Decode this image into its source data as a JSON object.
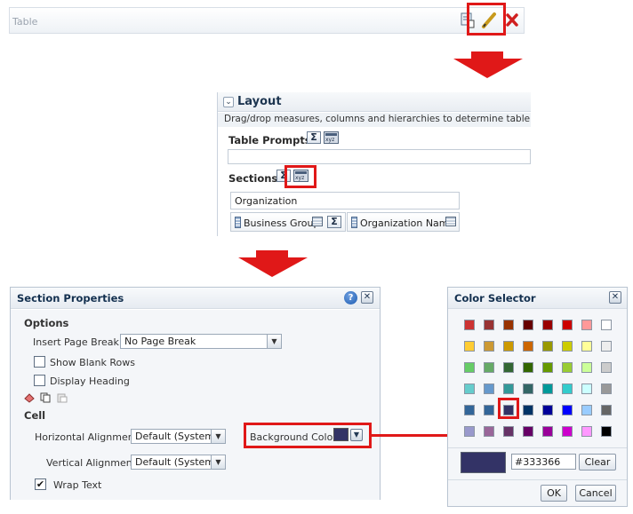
{
  "table_strip": {
    "title": "Table"
  },
  "layout": {
    "header": "Layout",
    "description": "Drag/drop measures, columns and hierarchies to determine table layout",
    "table_prompts_label": "Table Prompts",
    "sections_label": "Sections",
    "section_header_value": "Organization",
    "columns": [
      {
        "label": "Business Group"
      },
      {
        "label": "Organization Name"
      }
    ],
    "sigma_glyph": "Σ"
  },
  "section_properties": {
    "title": "Section Properties",
    "help_glyph": "?",
    "close_glyph": "✕",
    "options_heading": "Options",
    "insert_page_break_label": "Insert Page Break:",
    "insert_page_break_value": "No Page Break",
    "show_blank_rows_label": "Show Blank Rows",
    "show_blank_rows_checked": false,
    "display_heading_label": "Display Heading",
    "display_heading_checked": false,
    "cell_heading": "Cell",
    "horizontal_alignment_label": "Horizontal Alignment",
    "horizontal_alignment_value": "Default (System)",
    "vertical_alignment_label": "Vertical Alignment",
    "vertical_alignment_value": "Default (System)",
    "background_color_label": "Background Color",
    "background_color": "#333366",
    "wrap_text_label": "Wrap Text",
    "wrap_text_checked": true,
    "check_glyph": "✔",
    "dropdown_glyph": "▼"
  },
  "color_selector": {
    "title": "Color Selector",
    "close_glyph": "✕",
    "hex_value": "#333366",
    "clear_label": "Clear",
    "ok_label": "OK",
    "cancel_label": "Cancel",
    "selected_color": "#333366",
    "palette": [
      [
        "#cc3333",
        "#993333",
        "#993300",
        "#660000",
        "#990000",
        "#cc0000",
        "#ff9999",
        "#ffffff"
      ],
      [
        "#ffcc33",
        "#cc9933",
        "#cc9900",
        "#cc6600",
        "#999900",
        "#cccc00",
        "#ffff99",
        "#eeeeee"
      ],
      [
        "#66cc66",
        "#66aa66",
        "#336633",
        "#336600",
        "#669900",
        "#99cc33",
        "#ccff99",
        "#cccccc"
      ],
      [
        "#66cccc",
        "#6699cc",
        "#339999",
        "#336666",
        "#009999",
        "#33cccc",
        "#ccffff",
        "#999999"
      ],
      [
        "#336699",
        "#336699",
        "#333366",
        "#003366",
        "#000099",
        "#0000ff",
        "#99ccff",
        "#666666"
      ],
      [
        "#9999cc",
        "#996699",
        "#663366",
        "#660066",
        "#990099",
        "#cc00cc",
        "#ff99ff",
        "#000000"
      ]
    ]
  },
  "colors": {
    "highlight": "#e01818",
    "accent_title": "#13304f"
  }
}
